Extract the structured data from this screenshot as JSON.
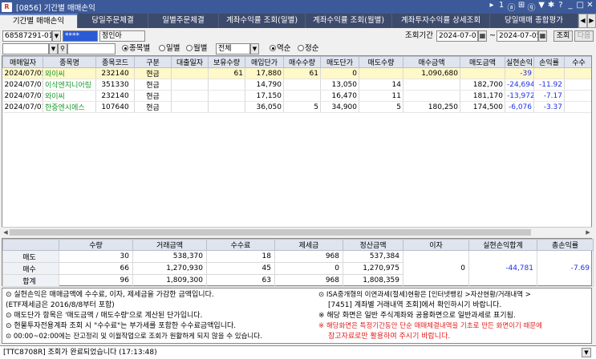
{
  "window": {
    "app_icon": "R",
    "title": "[0856] 기간별 매매손익",
    "controls": [
      "▸",
      "1",
      "ⓐ",
      "⊞",
      "ⓠ",
      "▼",
      "✱",
      "?",
      "_",
      "□",
      "✕"
    ]
  },
  "tabs": [
    {
      "label": "기간별 매매손익",
      "active": true
    },
    {
      "label": "당일주문체결",
      "active": false
    },
    {
      "label": "일별주문체결",
      "active": false
    },
    {
      "label": "계좌수익률 조회(일별)",
      "active": false
    },
    {
      "label": "계좌수익률 조회(월별)",
      "active": false
    },
    {
      "label": "계좌투자수익률 상세조회",
      "active": false
    },
    {
      "label": "당일매매 종합평가",
      "active": false
    }
  ],
  "tab_arrows": {
    "left": "◀",
    "right": "▶"
  },
  "filters": {
    "account_number": "68587291-01",
    "password_mask": "****",
    "account_holder": "정인아",
    "period_label": "조회기간",
    "date_from": "2024-07-01",
    "date_to": "2024-07-05",
    "date_sep": "~",
    "search_button": "조회",
    "next_button": "다음",
    "stock_code": "",
    "view_options": {
      "by_stock": "종목별",
      "daily": "일별",
      "monthly": "월별",
      "selected": "by_stock"
    },
    "scope_value": "전체",
    "order_options": {
      "desc": "역순",
      "asc": "정순",
      "selected": "desc"
    }
  },
  "table": {
    "columns": [
      "매매일자",
      "종목명",
      "종목코드",
      "구분",
      "대출일자",
      "보유수량",
      "매입단가",
      "매수수량",
      "매도단가",
      "매도수량",
      "매수금액",
      "매도금액",
      "실현손익",
      "손익률",
      "수수"
    ],
    "rows": [
      {
        "date": "2024/07/05",
        "name": "와이씨",
        "code": "232140",
        "type": "현금",
        "loan_date": "",
        "hold_qty": "61",
        "buy_price": "17,880",
        "buy_qty": "61",
        "sell_price": "0",
        "sell_qty": "",
        "buy_amt": "1,090,680",
        "sell_amt": "",
        "pnl": "-39",
        "pnl_rate": "",
        "fee": ""
      },
      {
        "date": "2024/07/01",
        "name": "이삭엔지니어링",
        "code": "351330",
        "type": "현금",
        "loan_date": "",
        "hold_qty": "",
        "buy_price": "14,790",
        "buy_qty": "",
        "sell_price": "13,050",
        "sell_qty": "14",
        "buy_amt": "",
        "sell_amt": "182,700",
        "pnl": "-24,694",
        "pnl_rate": "-11.92",
        "fee": ""
      },
      {
        "date": "2024/07/01",
        "name": "와이씨",
        "code": "232140",
        "type": "현금",
        "loan_date": "",
        "hold_qty": "",
        "buy_price": "17,150",
        "buy_qty": "",
        "sell_price": "16,470",
        "sell_qty": "11",
        "buy_amt": "",
        "sell_amt": "181,170",
        "pnl": "-13,972",
        "pnl_rate": "-7.17",
        "fee": ""
      },
      {
        "date": "2024/07/01",
        "name": "한중엔시에스",
        "code": "107640",
        "type": "현금",
        "loan_date": "",
        "hold_qty": "",
        "buy_price": "36,050",
        "buy_qty": "5",
        "sell_price": "34,900",
        "sell_qty": "5",
        "buy_amt": "180,250",
        "sell_amt": "174,500",
        "pnl": "-6,076",
        "pnl_rate": "-3.37",
        "fee": ""
      }
    ]
  },
  "summary": {
    "headers": [
      "",
      "수량",
      "거래금액",
      "수수료",
      "제세금",
      "정산금액",
      "이자",
      "실현손익합계",
      "총손익률"
    ],
    "rows": [
      {
        "label": "매도",
        "qty": "30",
        "amount": "538,370",
        "fee": "18",
        "tax": "968",
        "settle": "537,384"
      },
      {
        "label": "매수",
        "qty": "66",
        "amount": "1,270,930",
        "fee": "45",
        "tax": "0",
        "settle": "1,270,975"
      },
      {
        "label": "합계",
        "qty": "96",
        "amount": "1,809,300",
        "fee": "63",
        "tax": "968",
        "settle": "1,808,359"
      }
    ],
    "interest": "0",
    "realized_total": "-44,781",
    "total_rate": "-7.69"
  },
  "notes": {
    "left": [
      "⊙ 실현손익은 매매금액에 수수료, 이자, 제세금을 가감한 금액입니다.",
      "   (ETF제세금은 2016/8/8부터 포함)",
      "⊙ 매도단가 항목은 '매도금액 / 매도수량'으로 계산된 단가입니다.",
      "⊙ 현물투자전용계좌 조회 시 \"수수료\"는 부가세를 포함한 수수료금액입니다.",
      "⊙ 00:00~02:00에는 잔고정리 및 이월작업으로 조회가 원활하게 되지 않을 수 있습니다."
    ],
    "right": [
      "⊙ ISA중개형의 이연과세(절세)현황은 [인터넷뱅킹 >자산현황/거래내역 >",
      "[7451] 계좌별 거래내역 조회]에서 확인하시기 바랍니다.",
      "※ 해당 화면은 일반 주식계좌와 공용화면으로 일반과세로 표기됨.",
      "※ 해당화면은 특정기간동안 단순 매매체결내역을 기초로 만든 화면이기 때문에",
      "참고자료로만 활용하여 주시기 바랍니다."
    ]
  },
  "status": {
    "message": "[TTC8708R] 조회가 완료되었습니다 (17:13:48)",
    "dropdown": "▼"
  },
  "colors": {
    "title_bg": "#3c5a9a",
    "tab_bg": "#3c4a6b",
    "stock_name": "#1a9a2a",
    "negative": "#2030e0",
    "warning": "#e02020",
    "selected_row": "#fff8c8"
  }
}
